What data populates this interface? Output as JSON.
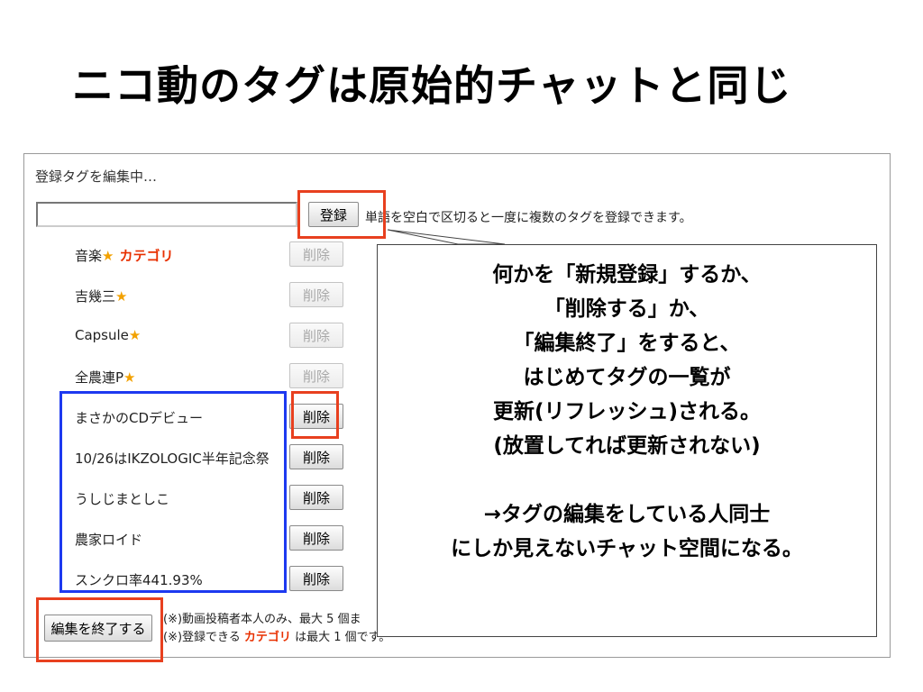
{
  "slide": {
    "title": "ニコ動のタグは原始的チャットと同じ"
  },
  "tag_editor": {
    "heading": "登録タグを編集中…",
    "input_value": "",
    "register_label": "登録",
    "register_hint": "単語を空白で区切ると一度に複数のタグを登録できます。",
    "tags": [
      {
        "name": "音楽",
        "star": "★",
        "category": "カテゴリ",
        "delete_label": "削除",
        "enabled": false
      },
      {
        "name": "吉幾三",
        "star": "★",
        "category": "",
        "delete_label": "削除",
        "enabled": false
      },
      {
        "name": "Capsule",
        "star": "★",
        "category": "",
        "delete_label": "削除",
        "enabled": false
      },
      {
        "name": "全農連P",
        "star": "★",
        "category": "",
        "delete_label": "削除",
        "enabled": false
      },
      {
        "name": "まさかのCDデビュー",
        "star": "",
        "category": "",
        "delete_label": "削除",
        "enabled": true
      },
      {
        "name": "10/26はIKZOLOGIC半年記念祭",
        "star": "",
        "category": "",
        "delete_label": "削除",
        "enabled": true
      },
      {
        "name": "うしじまとしこ",
        "star": "",
        "category": "",
        "delete_label": "削除",
        "enabled": true
      },
      {
        "name": "農家ロイド",
        "star": "",
        "category": "",
        "delete_label": "削除",
        "enabled": true
      },
      {
        "name": "スンクロ率441.93%",
        "star": "",
        "category": "",
        "delete_label": "削除",
        "enabled": true
      }
    ],
    "finish_label": "編集を終了する",
    "note1": "(※)動画投稿者本人のみ、最大 5 個ま",
    "note2_prefix": "(※)登録できる ",
    "note2_category": "カテゴリ",
    "note2_suffix": " は最大 1 個です。"
  },
  "callout": {
    "lines": [
      "何かを「新規登録」するか、",
      "「削除する」か、",
      "「編集終了」をすると、",
      "はじめてタグの一覧が",
      "更新(リフレッシュ)される。",
      "(放置してれば更新されない)",
      "",
      "→タグの編集をしている人同士",
      "にしか見えないチャット空間になる。"
    ]
  },
  "colors": {
    "highlight_red": "#e8401f",
    "highlight_blue": "#1d39f0",
    "star": "#f2a100",
    "category": "#e83000"
  }
}
